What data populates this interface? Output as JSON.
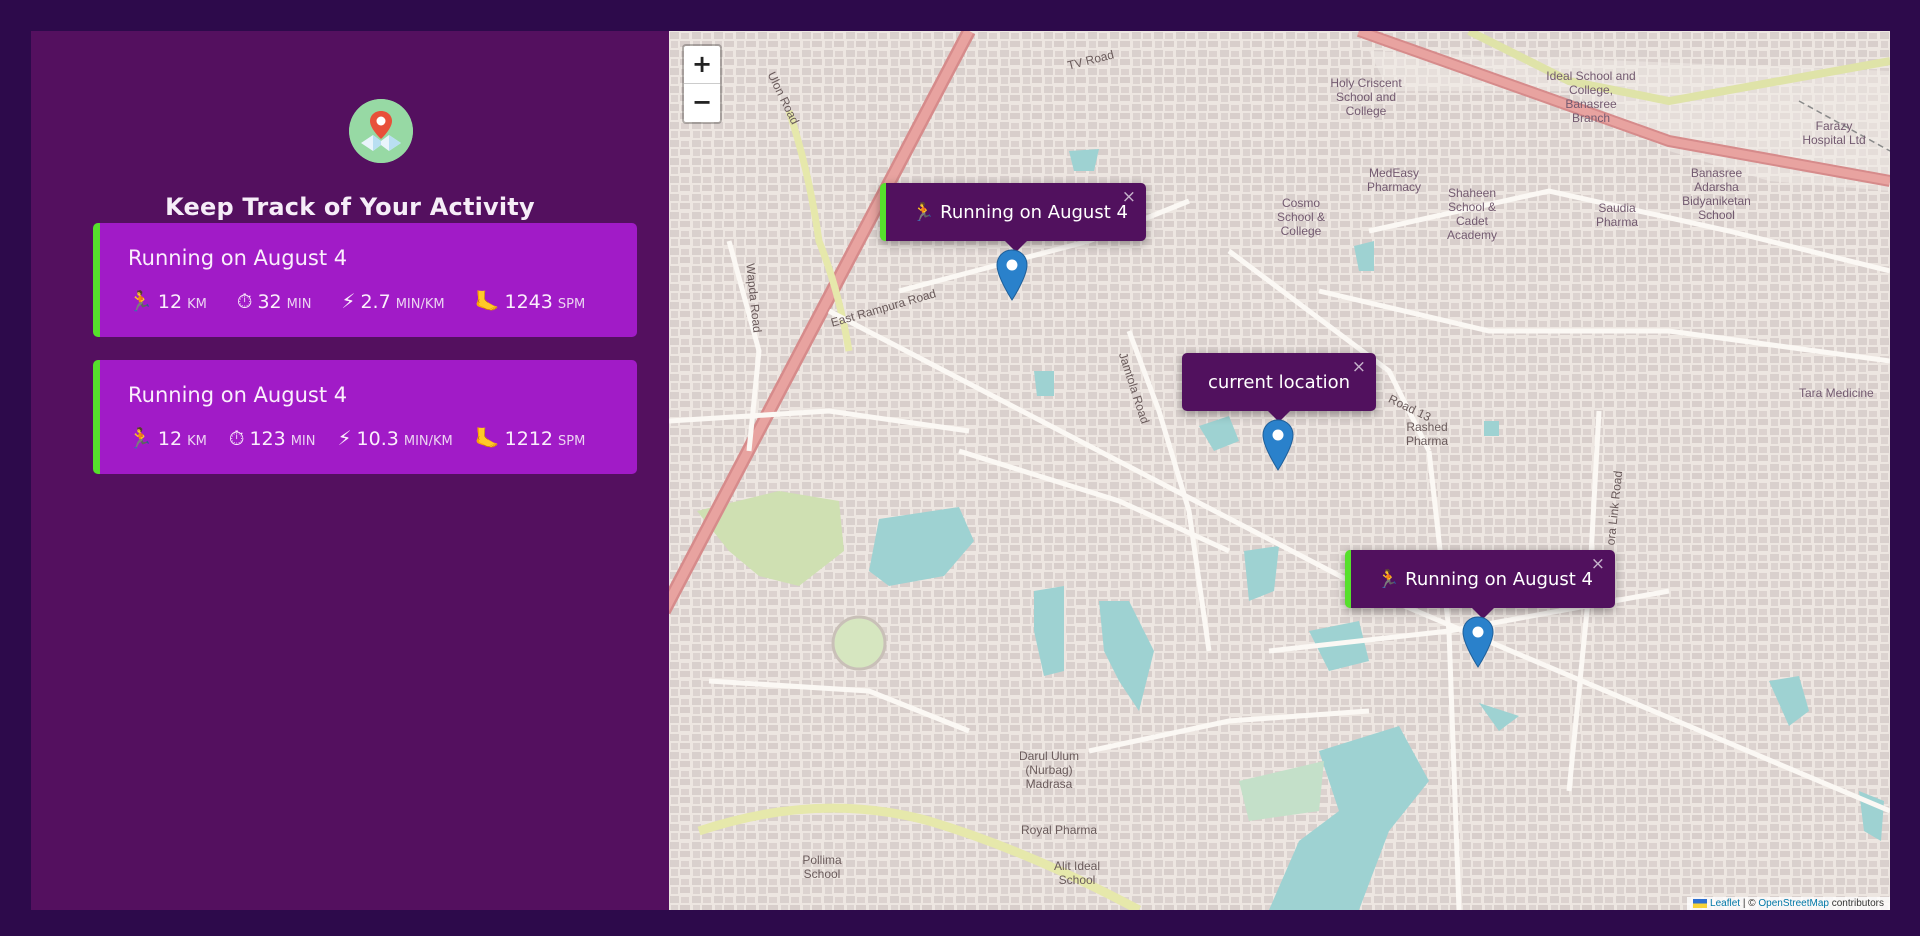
{
  "sidebar": {
    "logo_icon": "map-pin-icon",
    "title": "Keep Track of Your Activity",
    "workouts": [
      {
        "title": "Running on August 4",
        "stats": [
          {
            "icon": "🏃",
            "value": "12",
            "unit": "km"
          },
          {
            "icon": "⏱",
            "value": "32",
            "unit": "min"
          },
          {
            "icon": "⚡",
            "value": "2.7",
            "unit": "min/km"
          },
          {
            "icon": "🦶",
            "value": "1243",
            "unit": "spm"
          }
        ]
      },
      {
        "title": "Running on August 4",
        "stats": [
          {
            "icon": "🏃",
            "value": "12",
            "unit": "km"
          },
          {
            "icon": "⏱",
            "value": "123",
            "unit": "min"
          },
          {
            "icon": "⚡",
            "value": "10.3",
            "unit": "min/km"
          },
          {
            "icon": "🦶",
            "value": "1212",
            "unit": "spm"
          }
        ]
      }
    ]
  },
  "map": {
    "zoom_in": "+",
    "zoom_out": "−",
    "popups": [
      {
        "icon": "🏃",
        "text": "Running on August 4",
        "close": "×"
      },
      {
        "icon": "",
        "text": "current location",
        "close": "×"
      },
      {
        "icon": "🏃",
        "text": "Running on August 4",
        "close": "×"
      }
    ],
    "labels": {
      "tv_road": "TV Road",
      "east_rampura": "East Rampura Road",
      "jamtola": "Jamtola Road",
      "wapda": "Wapda Road",
      "ulon": "Ulon Road",
      "road13": "Road 13",
      "rashed": "Rashed Pharma",
      "darul": "Darul Ulum (Nurbag) Madrasa",
      "royal": "Royal Pharma",
      "alit": "Alit Ideal School",
      "pollima": "Pollima School",
      "holy": "Holy Criscent School and College",
      "ideal": "Ideal School and College, Banasree Branch",
      "medeasy": "MedEasy Pharmacy",
      "shaheen": "Shaheen School & Cadet Academy",
      "cosmo": "Cosmo School & College",
      "saudia": "Saudia Pharma",
      "banasree": "Banasree Adarsha Bidyaniketan School",
      "tara": "Tara Medicine",
      "farazy": "Farazy Hospital Ltd",
      "ora_link": "ora Link Road"
    },
    "attribution": {
      "leaflet": "Leaflet",
      "sep": " | © ",
      "osm": "OpenStreetMap",
      "suffix": " contributors"
    }
  },
  "colors": {
    "background": "#2d0a4b",
    "sidebar": "#54105f",
    "card": "#a11bc7",
    "accent": "#56e02c",
    "popup": "#51115e",
    "marker": "#2a81cb"
  }
}
